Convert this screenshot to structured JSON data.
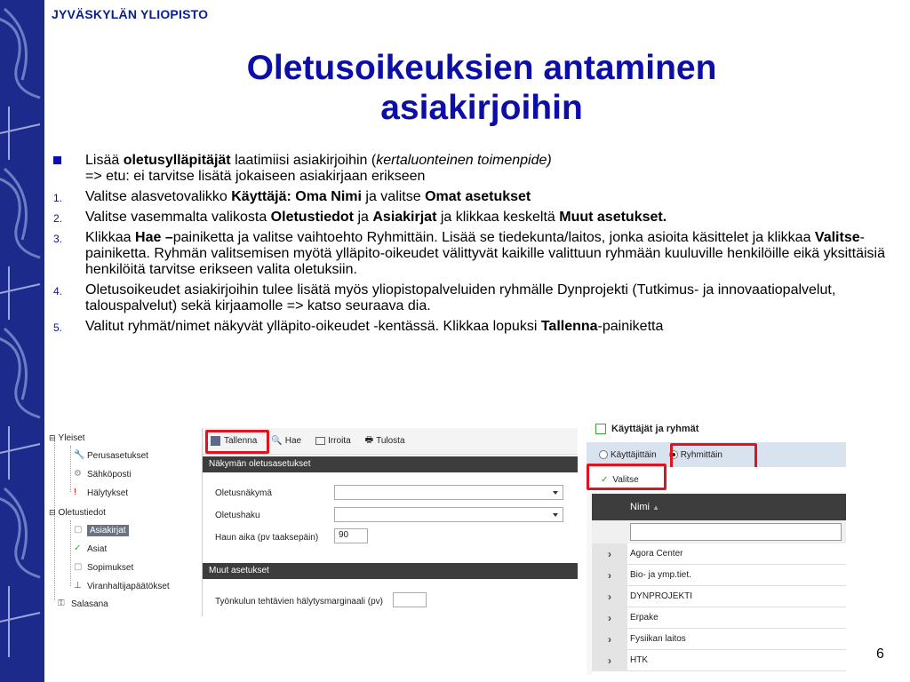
{
  "slide": {
    "university": "JYVÄSKYLÄN YLIOPISTO",
    "title_line1": "Oletusoikeuksien antaminen",
    "title_line2": "asiakirjoihin",
    "page_number": "6"
  },
  "bullet": {
    "t1": "Lisää ",
    "b1": "oletusylläpitäjät",
    "t2": " laatimiisi asiakirjoihin (",
    "i1": "kertaluonteinen toimenpide)",
    "line2": "=> etu: ei tarvitse lisätä jokaiseen asiakirjaan erikseen"
  },
  "steps": [
    {
      "num": "1.",
      "t1": "Valitse alasvetovalikko ",
      "b1": "Käyttäjä: Oma Nimi",
      "t2": " ja valitse ",
      "b2": "Omat asetukset"
    },
    {
      "num": "2.",
      "t1": "Valitse vasemmalta valikosta ",
      "b1": "Oletustiedot",
      "t2": " ja ",
      "b2": "Asiakirjat",
      "t3": " ja klikkaa keskeltä ",
      "b3": "Muut asetukset."
    },
    {
      "num": "3.",
      "t1": "Klikkaa ",
      "b1": "Hae –",
      "t2": "painiketta ja valitse vaihtoehto Ryhmittäin. Lisää se tiedekunta/laitos, jonka asioita käsittelet ja klikkaa ",
      "b2": "Valitse",
      "t3": "-painiketta. Ryhmän valitsemisen myötä ylläpito-oikeudet välittyvät kaikille valittuun ryhmään kuuluville henkilöille eikä yksittäisiä henkilöitä tarvitse erikseen valita oletuksiin."
    },
    {
      "num": "4.",
      "t1": "Oletusoikeudet asiakirjoihin tulee lisätä myös yliopistopalveluiden ryhmälle Dynprojekti (Tutkimus- ja innovaatiopalvelut, talouspalvelut) sekä kirjaamolle => katso seuraava dia."
    },
    {
      "num": "5.",
      "t1": "Valitut ryhmät/nimet näkyvät ylläpito-oikeudet  -kentässä. Klikkaa lopuksi ",
      "b1": "Tallenna",
      "t2": "-painiketta"
    }
  ],
  "tree": {
    "yleiset": "Yleiset",
    "perusasetukset": "Perusasetukset",
    "sahkoposti": "Sähköposti",
    "halytykset": "Hälytykset",
    "oletustiedot": "Oletustiedot",
    "asiakirjat": "Asiakirjat",
    "asiat": "Asiat",
    "sopimukset": "Sopimukset",
    "viranhaltijapaatokset": "Viranhaltijapäätökset",
    "salasana": "Salasana"
  },
  "settings": {
    "tallenna": "Tallenna",
    "hae": "Hae",
    "irroita": "Irroita",
    "tulosta": "Tulosta",
    "section1": "Näkymän oletusasetukset",
    "oletusnakyma": "Oletusnäkymä",
    "oletushaku": "Oletushaku",
    "haun_aika": "Haun aika (pv taaksepäin)",
    "haun_aika_value": "90",
    "section2": "Muut asetukset",
    "tyonkulku": "Työnkulun tehtävien hälytysmarginaali (pv)"
  },
  "dialog": {
    "title": "Käyttäjät ja ryhmät",
    "radio1": "Käyttäjittäin",
    "radio2": "Ryhmittäin",
    "valitse": "Valitse",
    "col_name": "Nimi",
    "rows": [
      "Agora Center",
      "Bio- ja ymp.tiet.",
      "DYNPROJEKTI",
      "Erpake",
      "Fysiikan laitos",
      "HTK"
    ]
  },
  "colors": {
    "strip": "#1c2a8c",
    "title": "#0b0fa8",
    "highlight_red": "#e0141e"
  }
}
